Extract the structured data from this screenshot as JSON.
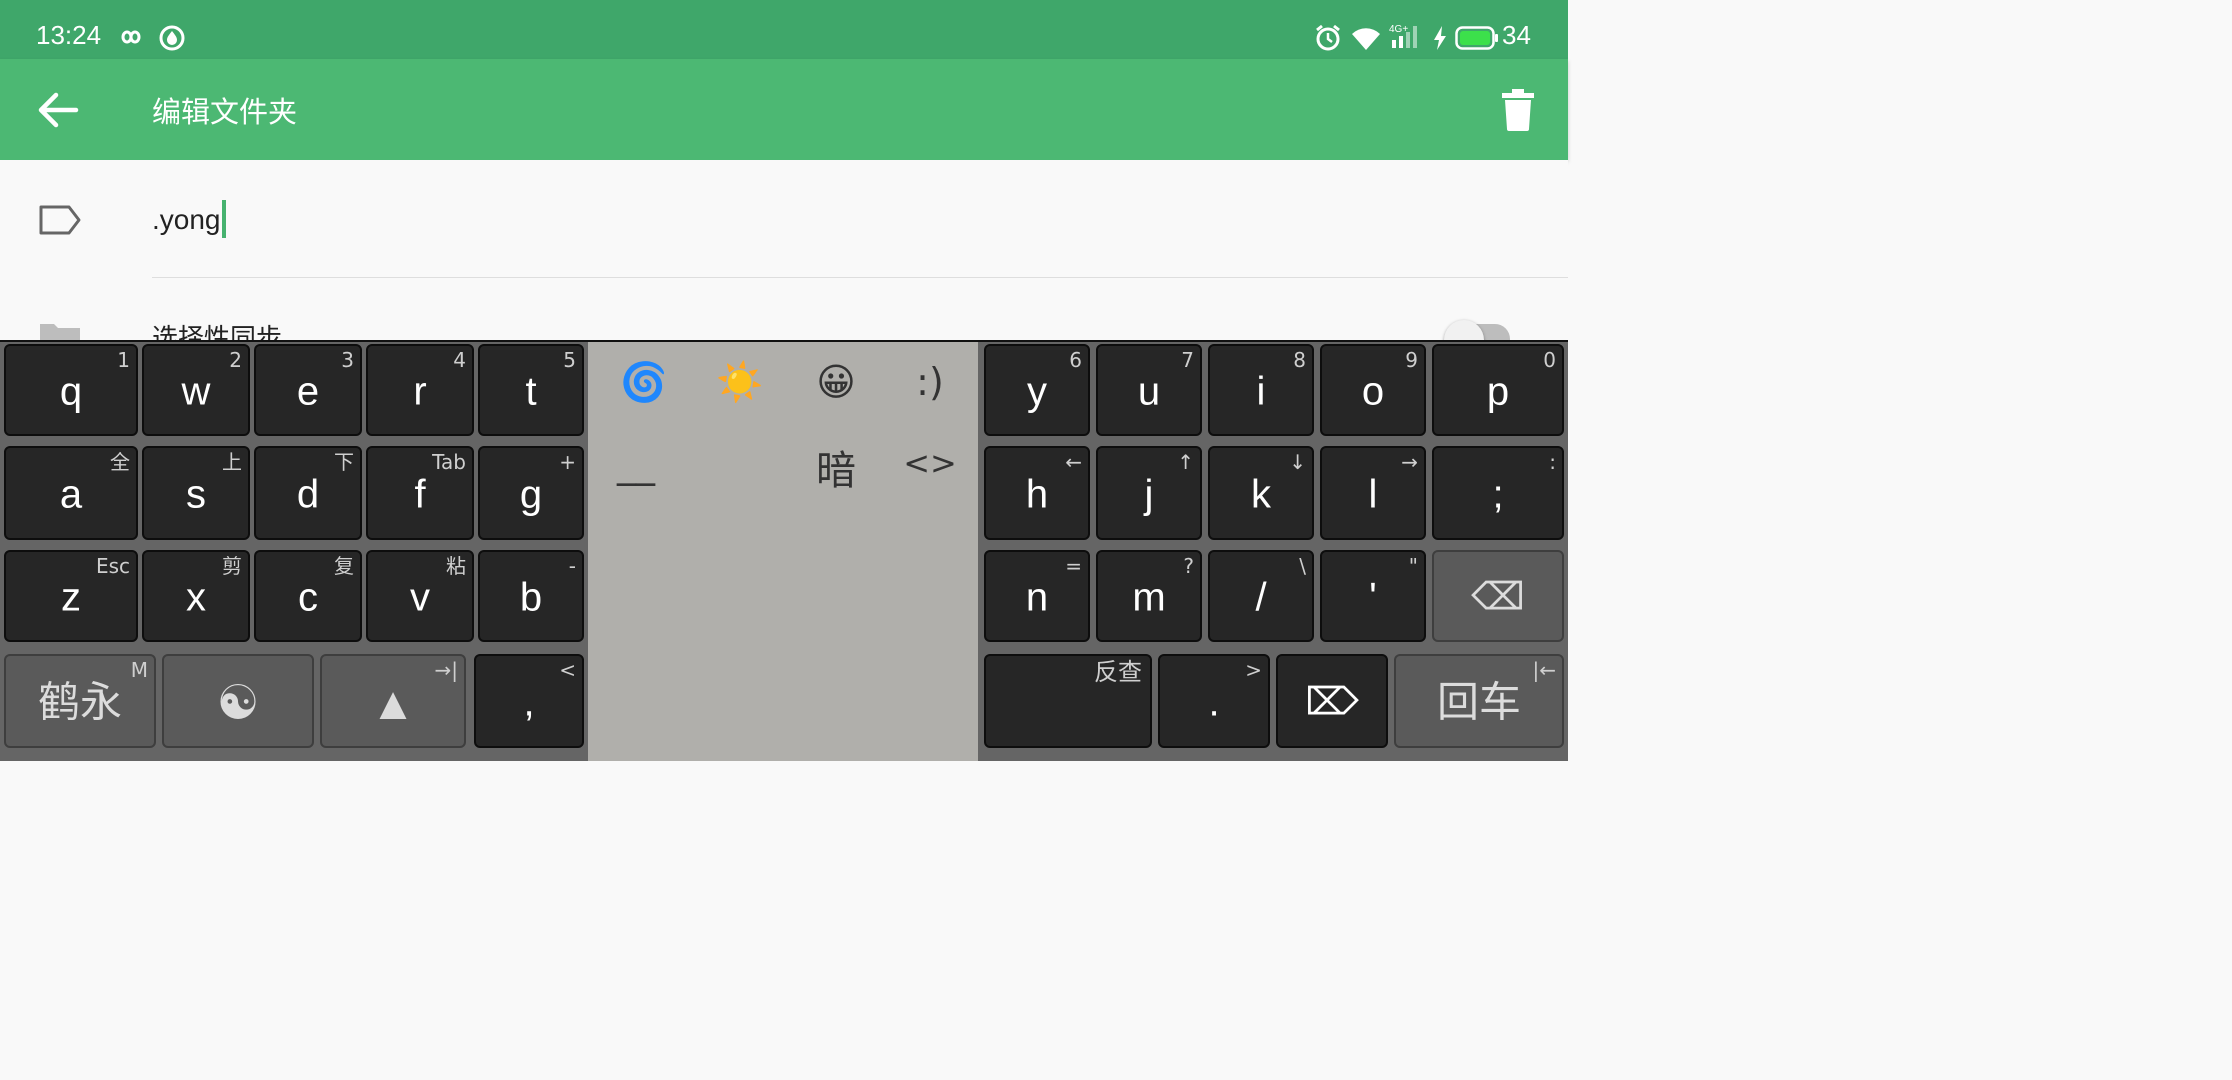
{
  "status_bar": {
    "time": "13:24",
    "battery": "34"
  },
  "app_bar": {
    "title": "编辑文件夹"
  },
  "form": {
    "folder_name": ".yong",
    "selective_sync_label": "选择性同步"
  },
  "candidates": {
    "row1": [
      "🌀",
      "☀️",
      "😀",
      ":)"
    ],
    "row2": [
      "__",
      "暗",
      "<>"
    ]
  },
  "keyboard": {
    "left_row1": [
      {
        "main": "q",
        "hint": "1"
      },
      {
        "main": "w",
        "hint": "2"
      },
      {
        "main": "e",
        "hint": "3"
      },
      {
        "main": "r",
        "hint": "4"
      },
      {
        "main": "t",
        "hint": "5"
      }
    ],
    "left_row2": [
      {
        "main": "a",
        "hint": "全"
      },
      {
        "main": "s",
        "hint": "上"
      },
      {
        "main": "d",
        "hint": "下"
      },
      {
        "main": "f",
        "hint": "Tab"
      },
      {
        "main": "g",
        "hint": "+"
      }
    ],
    "left_row3": [
      {
        "main": "z",
        "hint": "Esc"
      },
      {
        "main": "x",
        "hint": "剪"
      },
      {
        "main": "c",
        "hint": "复"
      },
      {
        "main": "v",
        "hint": "粘"
      },
      {
        "main": "b",
        "hint": "-"
      }
    ],
    "left_row4": [
      {
        "main": "鹤永",
        "hint": "M"
      },
      {
        "main": "☯",
        "hint": ""
      },
      {
        "main": "▲",
        "hint": "→|"
      },
      {
        "main": ",",
        "hint": "<"
      }
    ],
    "right_row1": [
      {
        "main": "y",
        "hint": "6"
      },
      {
        "main": "u",
        "hint": "7"
      },
      {
        "main": "i",
        "hint": "8"
      },
      {
        "main": "o",
        "hint": "9"
      },
      {
        "main": "p",
        "hint": "0"
      }
    ],
    "right_row2": [
      {
        "main": "h",
        "hint": "←"
      },
      {
        "main": "j",
        "hint": "↑"
      },
      {
        "main": "k",
        "hint": "↓"
      },
      {
        "main": "l",
        "hint": "→"
      },
      {
        "main": ";",
        "hint": ":"
      }
    ],
    "right_row3": [
      {
        "main": "n",
        "hint": "="
      },
      {
        "main": "m",
        "hint": "?"
      },
      {
        "main": "/",
        "hint": "\\"
      },
      {
        "main": "'",
        "hint": "\""
      },
      {
        "main": "⌫",
        "hint": ""
      }
    ],
    "right_row4": [
      {
        "main": "",
        "hint": "反查"
      },
      {
        "main": ".",
        "hint": ">"
      },
      {
        "main": "⌦",
        "hint": ""
      },
      {
        "main": "回车",
        "hint": "|←"
      }
    ]
  }
}
